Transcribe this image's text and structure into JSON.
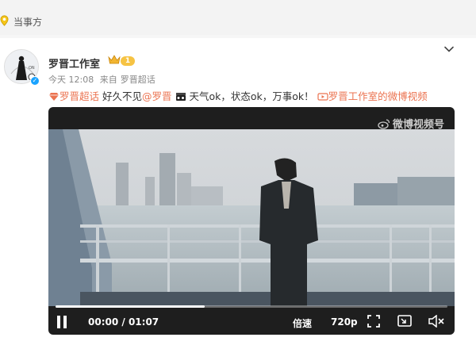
{
  "topic_bar": {
    "label": "当事方",
    "icon": "location-pin-icon"
  },
  "post": {
    "username": "罗晋工作室",
    "vip_level": "1",
    "time": "今天 12:08",
    "source_prefix": "来自",
    "source": "罗晋超话",
    "text": {
      "supertopic_link": "罗晋超话",
      "greeting": " 好久不见",
      "mention": "@罗晋",
      "body": " 天气ok，状态ok，万事ok！",
      "video_link": "罗晋工作室的微博视频"
    }
  },
  "video": {
    "watermark": "微博视频号",
    "current_time": "00:00",
    "duration": "01:07",
    "speed_label": "倍速",
    "quality_label": "720p",
    "progress": 0.38
  },
  "colors": {
    "link": "#eb7350",
    "vip": "#f6c343",
    "verified": "#1aa3ff"
  }
}
